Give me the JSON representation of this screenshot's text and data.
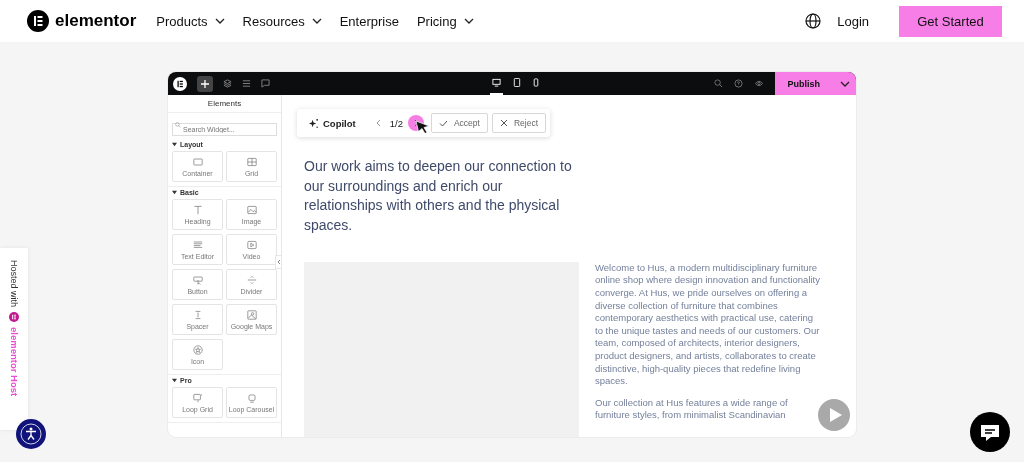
{
  "nav": {
    "brand": "elementor",
    "menu": [
      {
        "label": "Products",
        "has_dropdown": true
      },
      {
        "label": "Resources",
        "has_dropdown": true
      },
      {
        "label": "Enterprise",
        "has_dropdown": false
      },
      {
        "label": "Pricing",
        "has_dropdown": true
      }
    ],
    "login": "Login",
    "cta": "Get Started"
  },
  "editor": {
    "device_modes": [
      {
        "kind": "desktop",
        "selected": true
      },
      {
        "kind": "tablet",
        "selected": false
      },
      {
        "kind": "mobile",
        "selected": false
      }
    ],
    "publish": "Publish",
    "sidebar": {
      "title": "Elements",
      "search": {
        "placeholder": "Search Widget..."
      },
      "sections": [
        {
          "title": "Layout",
          "expanded": true,
          "widgets": [
            {
              "kind": "container",
              "label": "Container"
            },
            {
              "kind": "grid",
              "label": "Grid"
            }
          ]
        },
        {
          "title": "Basic",
          "expanded": true,
          "widgets": [
            {
              "kind": "heading",
              "label": "Heading"
            },
            {
              "kind": "image",
              "label": "Image"
            },
            {
              "kind": "text-editor",
              "label": "Text Editor"
            },
            {
              "kind": "video",
              "label": "Video"
            },
            {
              "kind": "button",
              "label": "Button"
            },
            {
              "kind": "divider",
              "label": "Divider"
            },
            {
              "kind": "spacer",
              "label": "Spacer"
            },
            {
              "kind": "google-maps",
              "label": "Google Maps"
            },
            {
              "kind": "icon",
              "label": "Icon"
            }
          ]
        },
        {
          "title": "Pro",
          "expanded": true,
          "widgets": [
            {
              "kind": "loop-grid",
              "label": "Loop Grid"
            },
            {
              "kind": "loop-carousel",
              "label": "Loop Carousel"
            }
          ]
        }
      ]
    },
    "copilot": {
      "label": "Copilot",
      "counter": "1/2",
      "accept": "Accept",
      "reject": "Reject"
    },
    "heading": "Our work aims to deepen our connection to our surroundings and enrich our relationships with others and the physical spaces.",
    "paragraphs": [
      "Welcome to Hus, a modern multidisciplinary furniture online shop where design innovation and functionality converge. At Hus, we pride ourselves on offering a diverse collection of furniture that combines contemporary aesthetics with practical use, catering to the unique tastes and needs of our customers. Our team, composed of architects, interior designers, product designers, and artists, collaborates to create distinctive, high-quality pieces that redefine living spaces.",
      "Our collection at Hus features a wide range of furniture styles, from minimalist Scandinavian"
    ]
  },
  "side_tab": {
    "prefix": "Hosted with",
    "brand": "elementor Host"
  }
}
